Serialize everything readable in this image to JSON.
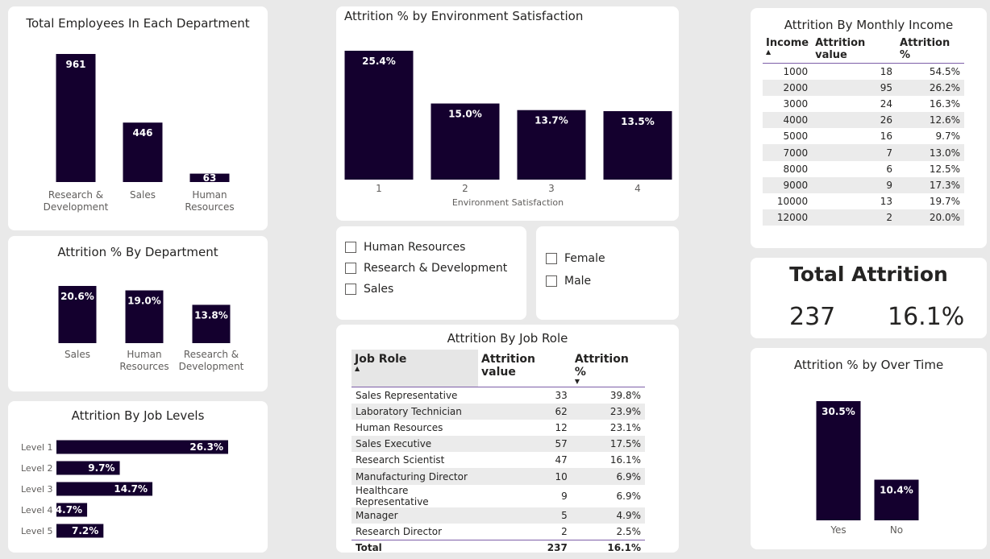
{
  "dept_employees": {
    "title": "Total Employees In Each Department",
    "chart_data": {
      "type": "bar",
      "categories": [
        [
          "Research &",
          "Development"
        ],
        [
          "Sales"
        ],
        [
          "Human",
          "Resources"
        ]
      ],
      "values": [
        961,
        446,
        63
      ],
      "labels": [
        "961",
        "446",
        "63"
      ],
      "ylim": [
        0,
        961
      ]
    }
  },
  "env_satisfaction": {
    "title": "Attrition % by Environment Satisfaction",
    "chart_data": {
      "type": "bar",
      "categories": [
        "1",
        "2",
        "3",
        "4"
      ],
      "values": [
        25.4,
        15.0,
        13.7,
        13.5
      ],
      "labels": [
        "25.4%",
        "15.0%",
        "13.7%",
        "13.5%"
      ],
      "xlabel": "Environment Satisfaction",
      "ylim": [
        0,
        25.4
      ]
    }
  },
  "monthly_income": {
    "title": "Attrition By Monthly Income",
    "columns": [
      "Income",
      "Attrition value",
      "Attrition %"
    ],
    "rows": [
      [
        "1000",
        "18",
        "54.5%"
      ],
      [
        "2000",
        "95",
        "26.2%"
      ],
      [
        "3000",
        "24",
        "16.3%"
      ],
      [
        "4000",
        "26",
        "12.6%"
      ],
      [
        "5000",
        "16",
        "9.7%"
      ],
      [
        "7000",
        "7",
        "13.0%"
      ],
      [
        "8000",
        "6",
        "12.5%"
      ],
      [
        "9000",
        "9",
        "17.3%"
      ],
      [
        "10000",
        "13",
        "19.7%"
      ],
      [
        "12000",
        "2",
        "20.0%"
      ]
    ]
  },
  "dept_attrition": {
    "title": "Attrition % By Department",
    "chart_data": {
      "type": "bar",
      "categories": [
        [
          "Sales"
        ],
        [
          "Human",
          "Resources"
        ],
        [
          "Research &",
          "Development"
        ]
      ],
      "values": [
        20.6,
        19.0,
        13.8
      ],
      "labels": [
        "20.6%",
        "19.0%",
        "13.8%"
      ],
      "ylim": [
        0,
        20.6
      ]
    }
  },
  "dept_slicer": {
    "options": [
      "Human Resources",
      "Research & Development",
      "Sales"
    ]
  },
  "gender_slicer": {
    "options": [
      "Female",
      "Male"
    ]
  },
  "total_attrition": {
    "title": "Total Attrition",
    "count": "237",
    "percent": "16.1%"
  },
  "job_levels": {
    "title": "Attrition By Job Levels",
    "chart_data": {
      "type": "bar",
      "orientation": "horizontal",
      "categories": [
        "Level 1",
        "Level 2",
        "Level 3",
        "Level 4",
        "Level 5"
      ],
      "values": [
        26.3,
        9.7,
        14.7,
        4.7,
        7.2
      ],
      "labels": [
        "26.3%",
        "9.7%",
        "14.7%",
        "4.7%",
        "7.2%"
      ],
      "xlim": [
        0,
        26.3
      ]
    }
  },
  "job_role": {
    "title": "Attrition By Job Role",
    "columns": [
      "Job Role",
      "Attrition value",
      "Attrition %"
    ],
    "rows": [
      [
        "Sales Representative",
        "33",
        "39.8%"
      ],
      [
        "Laboratory Technician",
        "62",
        "23.9%"
      ],
      [
        "Human Resources",
        "12",
        "23.1%"
      ],
      [
        "Sales Executive",
        "57",
        "17.5%"
      ],
      [
        "Research Scientist",
        "47",
        "16.1%"
      ],
      [
        "Manufacturing Director",
        "10",
        "6.9%"
      ],
      [
        "Healthcare Representative",
        "9",
        "6.9%"
      ],
      [
        "Manager",
        "5",
        "4.9%"
      ],
      [
        "Research Director",
        "2",
        "2.5%"
      ]
    ],
    "total": [
      "Total",
      "237",
      "16.1%"
    ]
  },
  "over_time": {
    "title": "Attrition % by Over Time",
    "chart_data": {
      "type": "bar",
      "categories": [
        "Yes",
        "No"
      ],
      "values": [
        30.5,
        10.4
      ],
      "labels": [
        "30.5%",
        "10.4%"
      ],
      "ylim": [
        0,
        30.5
      ]
    }
  },
  "colors": {
    "bar": "#14002e",
    "accent": "#7d5fa8",
    "page": "#e9e9e9"
  },
  "icons": {
    "sort_up": "▲",
    "sort_down": "▼"
  }
}
